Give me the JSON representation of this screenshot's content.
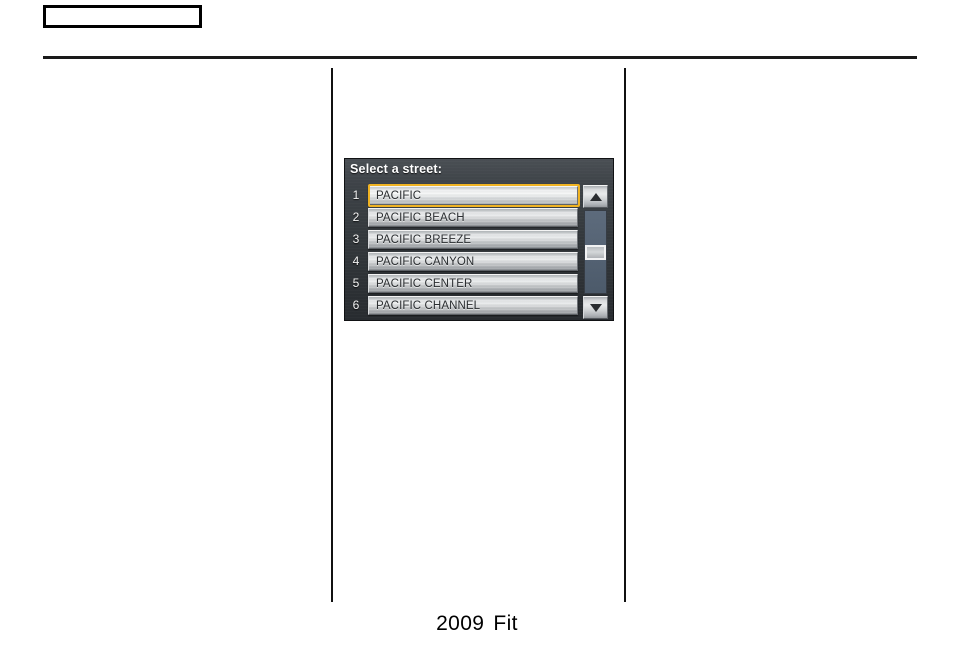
{
  "page": {
    "header_box_text": "",
    "footer": {
      "year": "2009",
      "model": "Fit"
    }
  },
  "nav_screen": {
    "title": "Select a street:",
    "selected_index": 1,
    "rows": [
      {
        "number": "1",
        "label": "PACIFIC"
      },
      {
        "number": "2",
        "label": "PACIFIC BEACH"
      },
      {
        "number": "3",
        "label": "PACIFIC BREEZE"
      },
      {
        "number": "4",
        "label": "PACIFIC CANYON"
      },
      {
        "number": "5",
        "label": "PACIFIC CENTER"
      },
      {
        "number": "6",
        "label": "PACIFIC CHANNEL"
      }
    ],
    "scrollbar": {
      "up_icon": "triangle-up-icon",
      "down_icon": "triangle-down-icon",
      "thumb_position_pct": 40
    },
    "colors": {
      "highlight_border": "#f0b323",
      "panel_dark": "#34393d",
      "button_silver": "#d3d6d8",
      "track_blue": "#556374"
    }
  }
}
